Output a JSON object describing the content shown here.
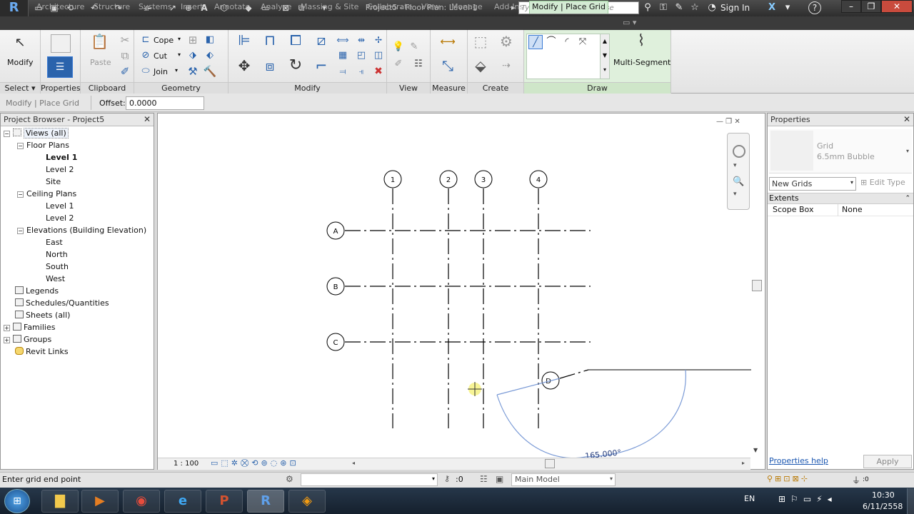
{
  "titlebar": {
    "logo": "R",
    "title": "Project5 - Floor Plan: Level 1",
    "search_placeholder": "Type a keyword or phrase",
    "signin": "Sign In",
    "help": "?"
  },
  "tabs": [
    "Architecture",
    "Structure",
    "Systems",
    "Insert",
    "Annotate",
    "Analyze",
    "Massing & Site",
    "Collaborate",
    "View",
    "Manage",
    "Add-Ins",
    "Modify | Place Grid"
  ],
  "ribbon": {
    "select": {
      "modify": "Modify",
      "label": "Select ▾"
    },
    "properties": {
      "label": "Properties"
    },
    "clipboard": {
      "paste": "Paste",
      "label": "Clipboard"
    },
    "geometry": {
      "cope": "Cope",
      "cut": "Cut",
      "join": "Join",
      "label": "Geometry"
    },
    "modify": {
      "label": "Modify"
    },
    "view": {
      "label": "View"
    },
    "measure": {
      "label": "Measure"
    },
    "create": {
      "label": "Create"
    },
    "draw": {
      "multi_segment": "Multi-Segment",
      "label": "Draw"
    }
  },
  "optionsbar": {
    "context": "Modify | Place Grid",
    "offset_label": "Offset:",
    "offset_value": "0.0000"
  },
  "project_browser": {
    "title": "Project Browser - Project5",
    "items": [
      "Views (all)",
      "Floor Plans",
      "Level 1",
      "Level 2",
      "Site",
      "Ceiling Plans",
      "Level 1",
      "Level 2",
      "Elevations (Building Elevation)",
      "East",
      "North",
      "South",
      "West",
      "Legends",
      "Schedules/Quantities",
      "Sheets (all)",
      "Families",
      "Groups",
      "Revit Links"
    ]
  },
  "canvas": {
    "grid_vertical": [
      "1",
      "2",
      "3",
      "4"
    ],
    "grid_horizontal": [
      "A",
      "B",
      "C"
    ],
    "new_grid": "D",
    "angle": "165.000°",
    "scale": "1 : 100"
  },
  "properties": {
    "title": "Properties",
    "type_family": "Grid",
    "type_name": "6.5mm Bubble",
    "selector": "New Grids",
    "edit_type": "Edit Type",
    "section": "Extents",
    "rows": [
      {
        "name": "Scope Box",
        "value": "None"
      }
    ],
    "help_link": "Properties help",
    "apply": "Apply"
  },
  "statusbar": {
    "message": "Enter grid end point",
    "zero1": ":0",
    "model": "Main Model",
    "zero2": ":0"
  },
  "taskbar": {
    "lang": "EN",
    "time": "10:30",
    "date": "6/11/2558"
  },
  "colors": {
    "accent": "#2a63ac",
    "context_tab": "#d3ead3",
    "sketch_blue": "#7a9ad6"
  }
}
